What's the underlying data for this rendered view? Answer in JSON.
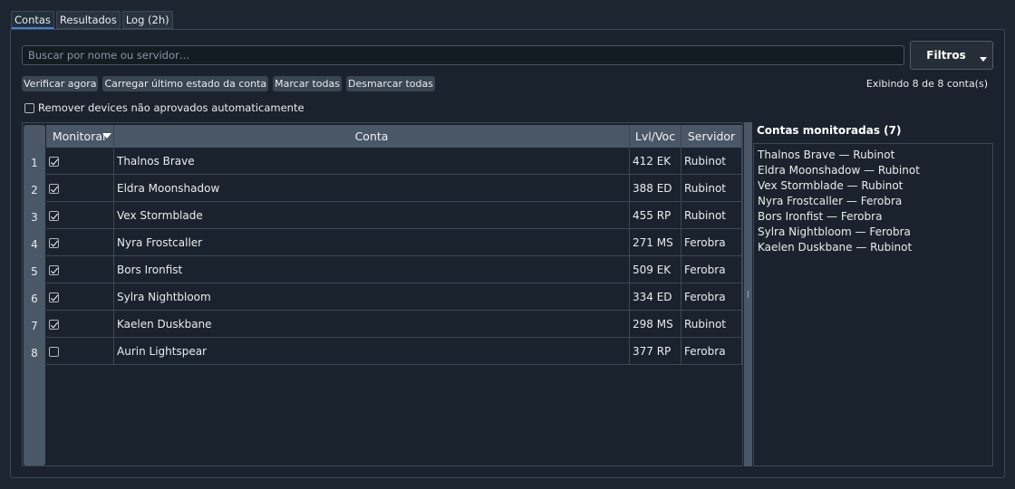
{
  "tabs": [
    {
      "label": "Contas",
      "active": true
    },
    {
      "label": "Resultados",
      "active": false
    },
    {
      "label": "Log (2h)",
      "active": false
    }
  ],
  "search": {
    "placeholder": "Buscar por nome ou servidor…",
    "value": ""
  },
  "filters": {
    "label": "Filtros"
  },
  "actions": {
    "verify_now": "Verificar agora",
    "load_last_state": "Carregar último estado da conta",
    "mark_all": "Marcar todas",
    "unmark_all": "Desmarcar todas"
  },
  "showing_count": "Exibindo 8 de 8 conta(s)",
  "auto_remove": {
    "label": "Remover devices não aprovados automaticamente",
    "checked": false
  },
  "table": {
    "columns": [
      "Monitorar",
      "Conta",
      "Lvl/Voc",
      "Servidor"
    ],
    "rows": [
      {
        "num": "1",
        "monitor": true,
        "account": "Thalnos Brave",
        "lvl": "412 EK",
        "server": "Rubinot"
      },
      {
        "num": "2",
        "monitor": true,
        "account": "Eldra Moonshadow",
        "lvl": "388 ED",
        "server": "Rubinot"
      },
      {
        "num": "3",
        "monitor": true,
        "account": "Vex Stormblade",
        "lvl": "455 RP",
        "server": "Rubinot"
      },
      {
        "num": "4",
        "monitor": true,
        "account": "Nyra Frostcaller",
        "lvl": "271 MS",
        "server": "Ferobra"
      },
      {
        "num": "5",
        "monitor": true,
        "account": "Bors Ironfist",
        "lvl": "509 EK",
        "server": "Ferobra"
      },
      {
        "num": "6",
        "monitor": true,
        "account": "Sylra Nightbloom",
        "lvl": "334 ED",
        "server": "Ferobra"
      },
      {
        "num": "7",
        "monitor": true,
        "account": "Kaelen Duskbane",
        "lvl": "298 MS",
        "server": "Rubinot"
      },
      {
        "num": "8",
        "monitor": false,
        "account": "Aurin Lightspear",
        "lvl": "377 RP",
        "server": "Ferobra"
      }
    ]
  },
  "monitored": {
    "title": "Contas monitoradas (7)",
    "items": [
      "Thalnos Brave — Rubinot",
      "Eldra Moonshadow — Rubinot",
      "Vex Stormblade — Rubinot",
      "Nyra Frostcaller — Ferobra",
      "Bors Ironfist — Ferobra",
      "Sylra Nightbloom — Ferobra",
      "Kaelen Duskbane — Rubinot"
    ]
  },
  "colors": {
    "accent": "#3d7fd6",
    "background": "#1c2530",
    "header": "#4a5766"
  }
}
